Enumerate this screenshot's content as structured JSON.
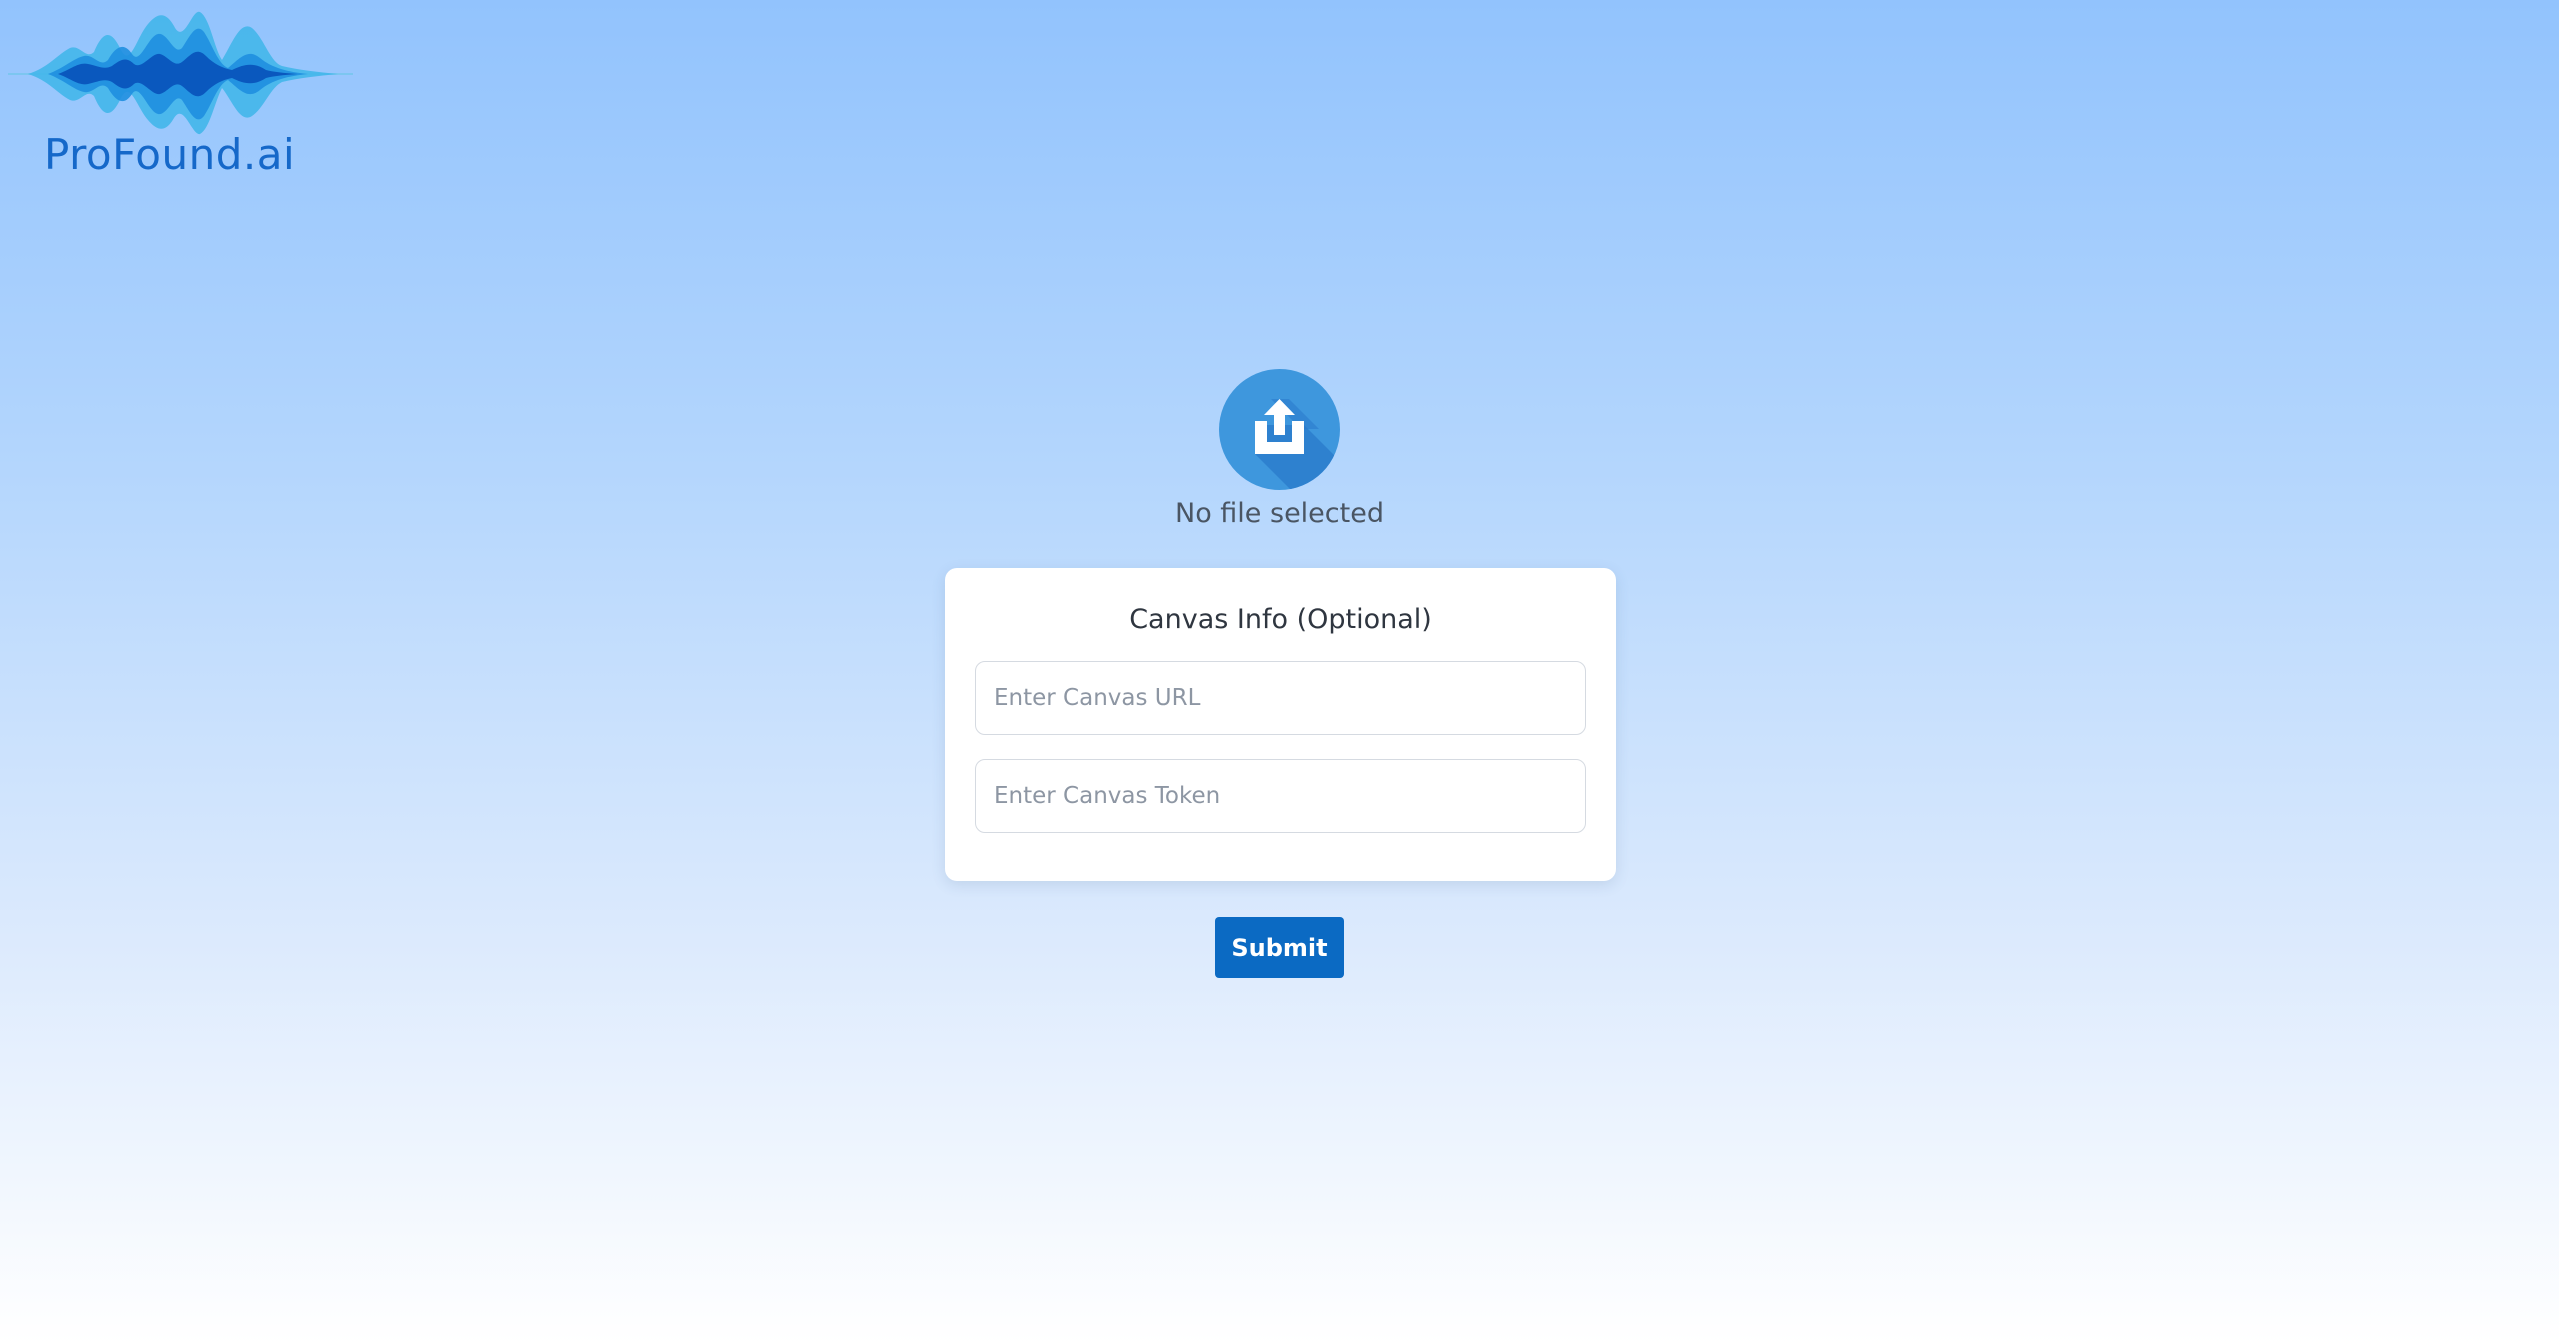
{
  "brand": {
    "name": "ProFound.ai",
    "logo_icon": "sound-wave-icon",
    "color": "#1568c9"
  },
  "uploader": {
    "icon": "upload-icon",
    "status_text": "No file selected",
    "circle_color": "#3e97dd"
  },
  "canvas_form": {
    "title": "Canvas Info (Optional)",
    "url_field": {
      "value": "",
      "placeholder": "Enter Canvas URL"
    },
    "token_field": {
      "value": "",
      "placeholder": "Enter Canvas Token"
    }
  },
  "actions": {
    "submit_label": "Submit",
    "submit_color": "#0b6ac3"
  }
}
